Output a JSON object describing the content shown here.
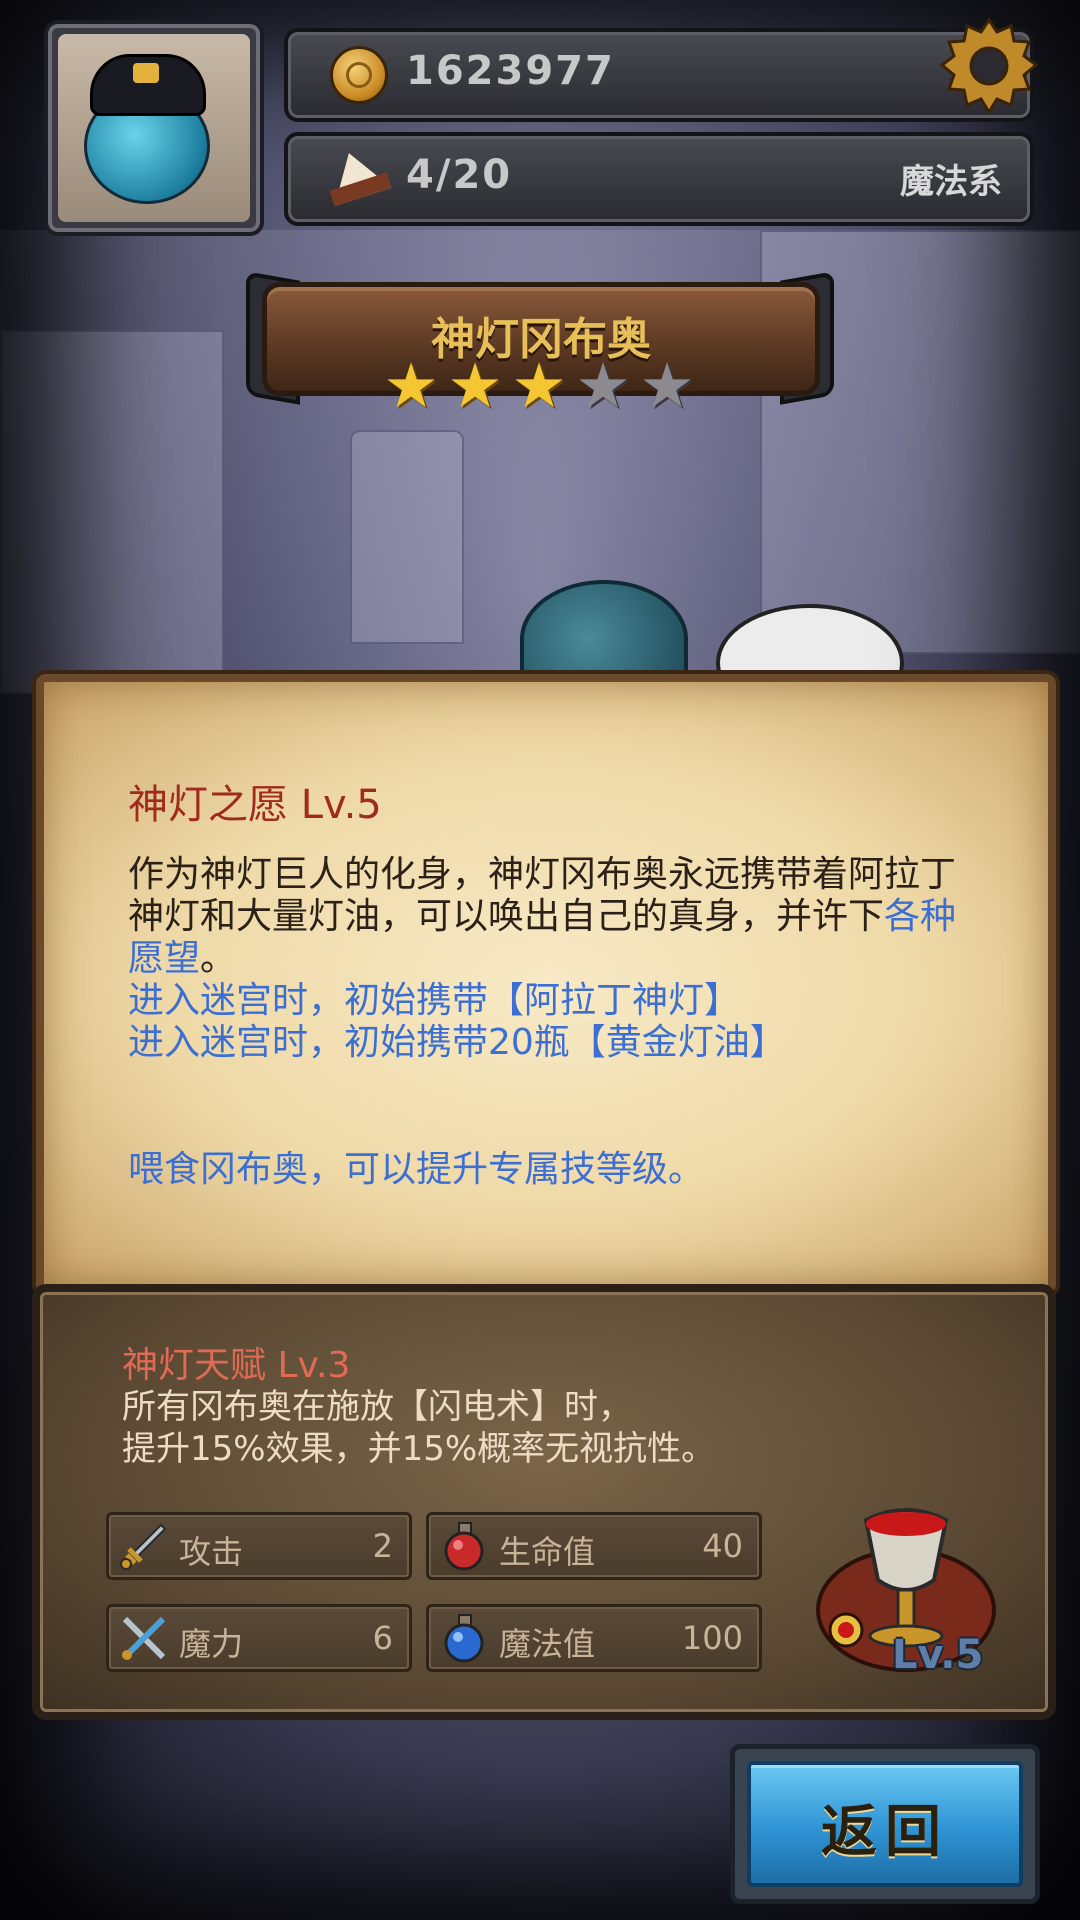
{
  "header": {
    "gold": "1623977",
    "food": "4/20",
    "category": "魔法系"
  },
  "hero": {
    "name": "神灯冈布奥",
    "stars_filled": 3,
    "stars_total": 5
  },
  "skill": {
    "title": "神灯之愿 Lv.5",
    "desc_black": "作为神灯巨人的化身，神灯冈布奥永远携带着阿拉丁神灯和大量灯油，可以唤出自己的真身，并许下",
    "desc_blue_inline": "各种愿望",
    "desc_end": "。",
    "effect_1": "进入迷宫时，初始携带【阿拉丁神灯】",
    "effect_2": "进入迷宫时，初始携带20瓶【黄金灯油】",
    "feed_hint": "喂食冈布奥，可以提升专属技等级。"
  },
  "talent": {
    "title": "神灯天赋 Lv.3",
    "line_1": "所有冈布奥在施放【闪电术】时，",
    "line_2": "提升15%效果，并15%概率无视抗性。"
  },
  "stats": [
    {
      "label": "攻击",
      "value": "2",
      "icon": "sword-icon"
    },
    {
      "label": "生命值",
      "value": "40",
      "icon": "red-potion-icon"
    },
    {
      "label": "魔力",
      "value": "6",
      "icon": "crossed-tools-icon"
    },
    {
      "label": "魔法值",
      "value": "100",
      "icon": "blue-potion-icon"
    }
  ],
  "relic": {
    "level": "Lv.5",
    "icon": "chalice-relic-icon"
  },
  "back_button": {
    "label": "返回"
  },
  "colors": {
    "skill_title": "#a02a1e",
    "blue_text": "#3b6fd4",
    "talent_title": "#e26a54",
    "star_on": "#f4c634",
    "star_off": "#8a8a90",
    "button_blue": "#2f93d4"
  }
}
